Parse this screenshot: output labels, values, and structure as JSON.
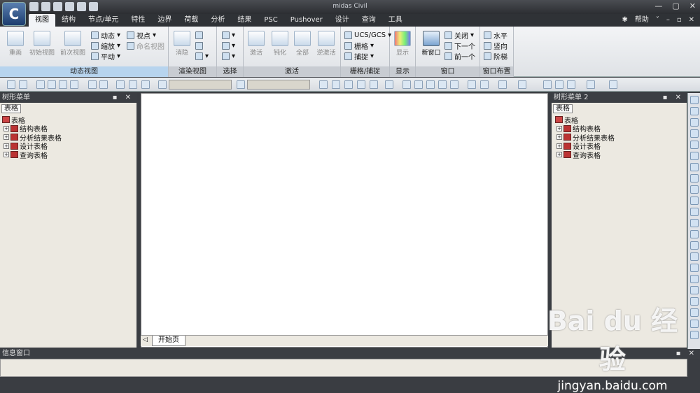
{
  "app": {
    "title": "midas Civil",
    "logo_text": "C"
  },
  "menu": {
    "tabs": [
      "视图",
      "结构",
      "节点/单元",
      "特性",
      "边界",
      "荷载",
      "分析",
      "结果",
      "PSC",
      "Pushover",
      "设计",
      "查询",
      "工具"
    ],
    "active_tab": "视图",
    "help_label": "帮助"
  },
  "ribbon": {
    "groups": {
      "dynamic_view": "动态视图",
      "render_view": "渲染视图",
      "select": "选择",
      "activate": "激活",
      "grid_snap": "栅格/捕捉",
      "display": "显示",
      "window": "窗口",
      "window_layout": "窗口布置"
    },
    "dynamic_view": {
      "redraw": "重画",
      "initial_view": "初始视图",
      "previous_view": "前次视图",
      "dynamic": "动态",
      "zoom": "缩放",
      "pan": "平动",
      "viewpoint": "视点",
      "named_view": "命名视图"
    },
    "render_view": {
      "hide": "消隐"
    },
    "activate": {
      "activate": "激活",
      "passivate": "钝化",
      "all": "全部",
      "inverse": "逆激活"
    },
    "grid_snap": {
      "ucs": "UCS/GCS",
      "grid": "栅格",
      "snap": "捕捉"
    },
    "display": {
      "display": "显示"
    },
    "window": {
      "new_window": "新窗口",
      "close": "关闭",
      "next": "下一个",
      "prev": "前一个"
    },
    "window_layout": {
      "horizontal": "水平",
      "vertical": "竖向",
      "cascade": "阶梯"
    }
  },
  "left_panel": {
    "title": "树形菜单",
    "tab": "表格",
    "root": "表格",
    "items": [
      "结构表格",
      "分析结果表格",
      "设计表格",
      "查询表格"
    ]
  },
  "right_panel": {
    "title": "树形菜单 2",
    "tab": "表格",
    "root": "表格",
    "items": [
      "结构表格",
      "分析结果表格",
      "设计表格",
      "查询表格"
    ]
  },
  "document": {
    "tab": "开始页"
  },
  "info": {
    "title": "信息窗口"
  },
  "watermark": {
    "brand": "Bai du 经验",
    "url": "jingyan.baidu.com"
  }
}
